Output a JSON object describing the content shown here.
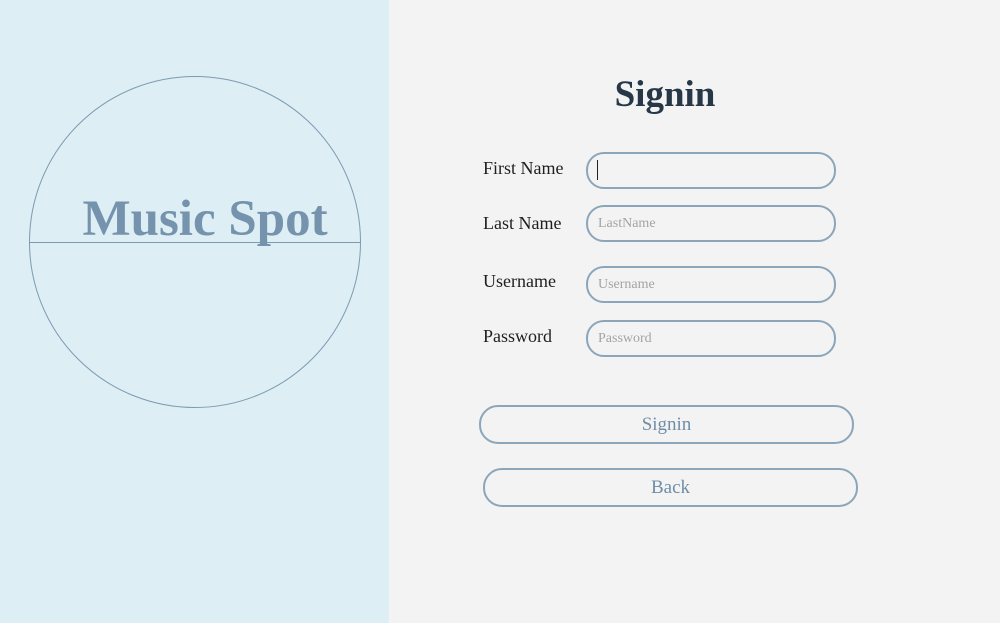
{
  "logo": {
    "text": "Music Spot"
  },
  "form": {
    "title": "Signin",
    "fields": [
      {
        "label": "First Name",
        "placeholder": "",
        "value": ""
      },
      {
        "label": "Last Name",
        "placeholder": "LastName",
        "value": ""
      },
      {
        "label": "Username",
        "placeholder": "Username",
        "value": ""
      },
      {
        "label": "Password",
        "placeholder": "Password",
        "value": ""
      }
    ],
    "signin_label": "Signin",
    "back_label": "Back"
  },
  "colors": {
    "left_panel_bg": "#deeef5",
    "right_panel_bg": "#f3f3f3",
    "accent": "#7593ad",
    "title": "#263847",
    "border": "#8ba6ba"
  }
}
